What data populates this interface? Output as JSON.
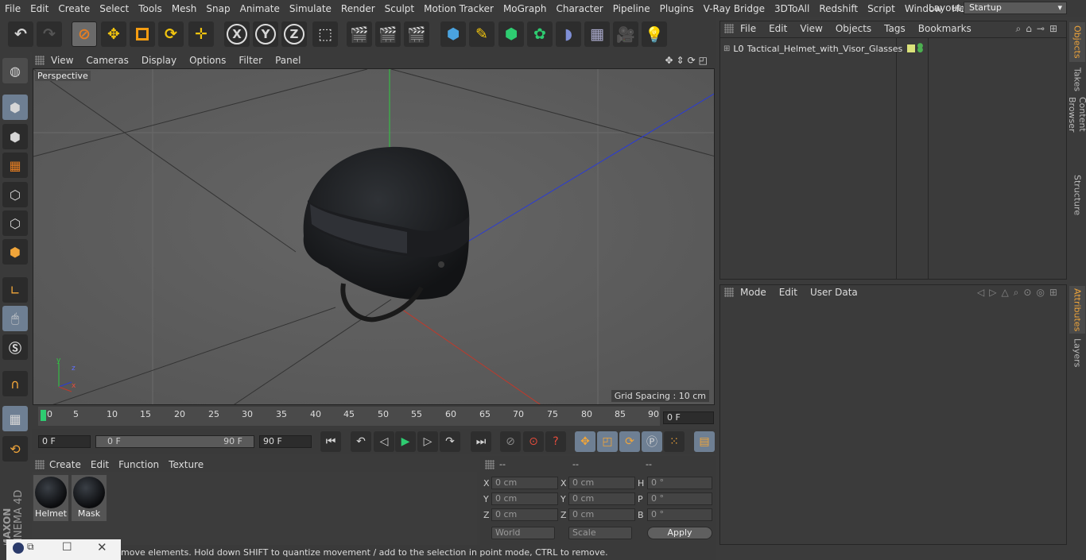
{
  "menu": [
    "File",
    "Edit",
    "Create",
    "Select",
    "Tools",
    "Mesh",
    "Snap",
    "Animate",
    "Simulate",
    "Render",
    "Sculpt",
    "Motion Tracker",
    "MoGraph",
    "Character",
    "Pipeline",
    "Plugins",
    "V-Ray Bridge",
    "3DToAll",
    "Redshift",
    "Script",
    "Window",
    "Help"
  ],
  "layout": {
    "label": "Layout:",
    "value": "Startup"
  },
  "toolbar": {
    "x_label": "X",
    "y_label": "Y",
    "z_label": "Z"
  },
  "viewport": {
    "menu": [
      "View",
      "Cameras",
      "Display",
      "Options",
      "Filter",
      "Panel"
    ],
    "camera": "Perspective",
    "grid_spacing": "Grid Spacing : 10 cm",
    "axis_y": "y",
    "axis_z": "z",
    "axis_x": "x"
  },
  "timeline": {
    "ticks": [
      "0",
      "5",
      "10",
      "15",
      "20",
      "25",
      "30",
      "35",
      "40",
      "45",
      "50",
      "55",
      "60",
      "65",
      "70",
      "75",
      "80",
      "85",
      "90"
    ],
    "current": "0 F",
    "start": "0 F",
    "range_start": "0 F",
    "range_end": "90 F",
    "end": "90 F"
  },
  "materials": {
    "menu": [
      "Create",
      "Edit",
      "Function",
      "Texture"
    ],
    "items": [
      {
        "name": "Helmet"
      },
      {
        "name": "Mask"
      }
    ]
  },
  "coords": {
    "headers": [
      "--",
      "--",
      "--"
    ],
    "rows": [
      {
        "l1": "X",
        "v1": "0 cm",
        "l2": "X",
        "v2": "0 cm",
        "l3": "H",
        "v3": "0 °"
      },
      {
        "l1": "Y",
        "v1": "0 cm",
        "l2": "Y",
        "v2": "0 cm",
        "l3": "P",
        "v3": "0 °"
      },
      {
        "l1": "Z",
        "v1": "0 cm",
        "l2": "Z",
        "v2": "0 cm",
        "l3": "B",
        "v3": "0 °"
      }
    ],
    "world": "World",
    "scale": "Scale",
    "apply": "Apply"
  },
  "objects": {
    "menu": [
      "File",
      "Edit",
      "View",
      "Objects",
      "Tags",
      "Bookmarks"
    ],
    "items": [
      {
        "name": "Tactical_Helmet_with_Visor_Glasses"
      }
    ]
  },
  "attributes": {
    "menu": [
      "Mode",
      "Edit",
      "User Data"
    ]
  },
  "right_tabs": [
    "Objects",
    "Takes",
    "Content Browser",
    "Structure",
    "Attributes",
    "Layers"
  ],
  "status": "move elements. Hold down SHIFT to quantize movement / add to the selection in point mode, CTRL to remove.",
  "brand": {
    "line1": "MAXON",
    "line2": "CINEMA 4D"
  },
  "colors": {
    "accent": "#f0a53a",
    "active_blue": "#6e7f93",
    "x_axis": "#c0392b",
    "y_axis": "#2ecc40",
    "z_axis": "#2a3bd6"
  }
}
